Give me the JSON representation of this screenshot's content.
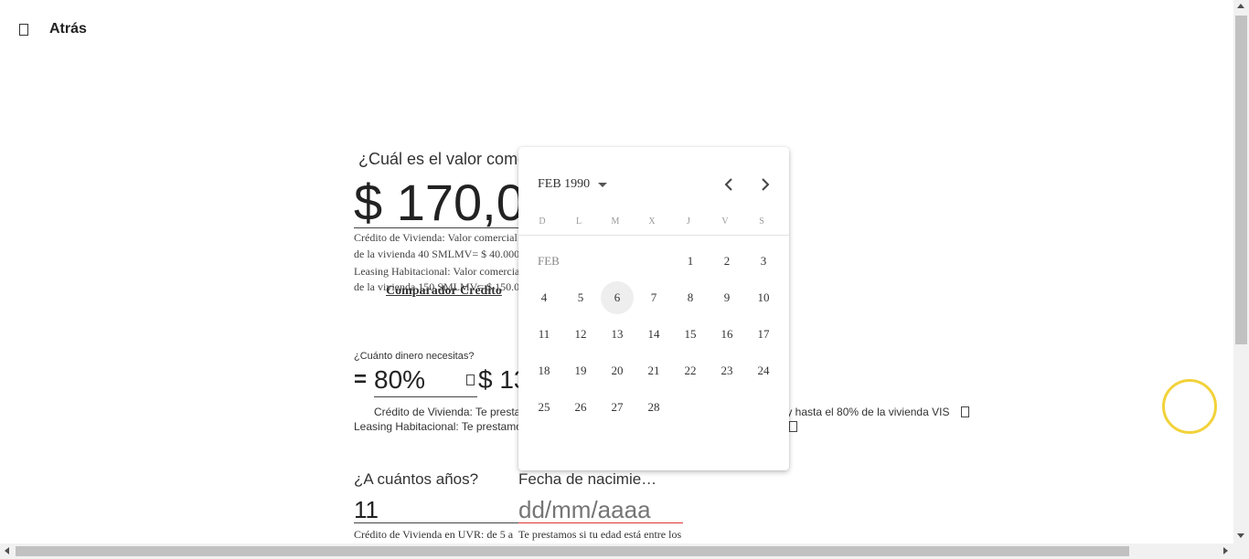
{
  "header": {
    "back_label": "Atrás"
  },
  "valor": {
    "question": "¿Cuál es el valor come",
    "amount": "$ 170,0",
    "notes": [
      "Crédito de Vivienda: Valor comercial",
      "de la vivienda 40 SMLMV= $ 40.000",
      "Leasing Habitacional: Valor comercia",
      "de la vivienda 150 SMLMV= $ 150.0"
    ],
    "comparador_link": "Comparador Crédito"
  },
  "dinero": {
    "question": "¿Cuánto dinero necesitas?",
    "equals": "=",
    "percent": "80%",
    "amount": "$ 13",
    "credito_text": "Crédito de Vivienda: Te prestan",
    "credito_tail": "S y hasta el 80% de la vivienda VIS",
    "leasing_text": "Leasing Habitacional: Te prestamos"
  },
  "anios": {
    "question": "¿A cuántos años?",
    "value": "11",
    "note": "Crédito de Vivienda en UVR: de 5 a"
  },
  "fecha": {
    "label": "Fecha de nacimie…",
    "placeholder": "dd/mm/aaaa",
    "note": "Te prestamos si tu edad está entre los"
  },
  "datepicker": {
    "month_year": "FEB 1990",
    "month_label": "FEB",
    "weekdays": [
      "D",
      "L",
      "M",
      "X",
      "J",
      "V",
      "S"
    ],
    "days": [
      "1",
      "2",
      "3",
      "4",
      "5",
      "6",
      "7",
      "8",
      "9",
      "10",
      "11",
      "12",
      "13",
      "14",
      "15",
      "16",
      "17",
      "18",
      "19",
      "20",
      "21",
      "22",
      "23",
      "24",
      "25",
      "26",
      "27",
      "28"
    ],
    "first_weekday_index": 4,
    "highlighted_day": "6"
  },
  "colors": {
    "ring": "#f2d23a",
    "error_underline": "#dd3333"
  },
  "icons": [
    "back-icon",
    "chevron-left-icon",
    "chevron-right-icon",
    "dropdown-caret-icon",
    "info-icon"
  ]
}
